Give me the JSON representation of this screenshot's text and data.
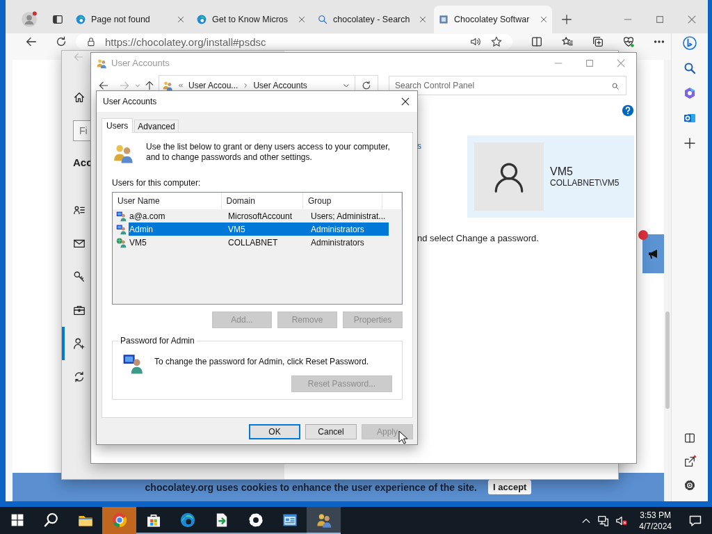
{
  "browser": {
    "tabs": [
      {
        "title": "Page not found",
        "kind": "edge",
        "selected": false
      },
      {
        "title": "Get to Know Micros",
        "kind": "edge",
        "selected": false
      },
      {
        "title": "chocolatey - Search",
        "kind": "search",
        "selected": false
      },
      {
        "title": "Chocolatey Softwar",
        "kind": "site",
        "selected": true
      }
    ],
    "address": "https://chocolatey.org/install#psdsc",
    "cookie_banner": {
      "text": "chocolatey.org uses cookies to enhance the user experience of the site.",
      "button": "I accept"
    }
  },
  "settings_window": {
    "search_placeholder": "Fi",
    "heading": "Acc",
    "nav": [
      {
        "kind": "contact",
        "selected": false
      },
      {
        "kind": "mail",
        "selected": false
      },
      {
        "kind": "key",
        "selected": false
      },
      {
        "kind": "briefcase",
        "selected": false
      },
      {
        "kind": "person-add",
        "selected": true
      },
      {
        "kind": "sync",
        "selected": false
      }
    ]
  },
  "control_panel": {
    "title": "User Accounts",
    "breadcrumb": [
      "User Accou...",
      "User Accounts"
    ],
    "search_placeholder": "Search Control Panel",
    "link_fragment": "s",
    "text_fragment": "nd select Change a password.",
    "user_card": {
      "name": "VM5",
      "account": "COLLABNET\\VM5"
    }
  },
  "dialog": {
    "title": "User Accounts",
    "tabs": [
      {
        "label": "Users",
        "selected": true
      },
      {
        "label": "Advanced",
        "selected": false
      }
    ],
    "intro": "Use the list below to grant or deny users access to your computer, and to change passwords and other settings.",
    "list_label": "Users for this computer:",
    "columns": [
      "User Name",
      "Domain",
      "Group"
    ],
    "rows": [
      {
        "kind": "local",
        "cells": [
          "a@a.com",
          "MicrosoftAccount",
          "Users; Administrat..."
        ],
        "selected": false
      },
      {
        "kind": "local",
        "cells": [
          "Admin",
          "VM5",
          "Administrators"
        ],
        "selected": true
      },
      {
        "kind": "domain",
        "cells": [
          "VM5",
          "COLLABNET",
          "Administrators"
        ],
        "selected": false
      }
    ],
    "list_buttons": [
      {
        "label": "Add...",
        "disabled": true
      },
      {
        "label": "Remove",
        "disabled": true
      },
      {
        "label": "Properties",
        "disabled": true
      }
    ],
    "password_group": {
      "legend": "Password for Admin",
      "text": "To change the password for Admin, click Reset Password.",
      "button": {
        "label": "Reset Password...",
        "disabled": true
      }
    },
    "buttons": [
      {
        "label": "OK",
        "disabled": false
      },
      {
        "label": "Cancel",
        "disabled": false
      },
      {
        "label": "Apply",
        "disabled": true
      }
    ]
  },
  "taskbar": {
    "apps": [
      {
        "kind": "start",
        "running": false,
        "active": false,
        "flashing": false
      },
      {
        "kind": "search",
        "running": false,
        "active": false,
        "flashing": false
      },
      {
        "kind": "folder",
        "running": false,
        "active": false,
        "flashing": false
      },
      {
        "kind": "chrome",
        "running": false,
        "active": false,
        "flashing": true
      },
      {
        "kind": "store",
        "running": true,
        "active": false,
        "flashing": false
      },
      {
        "kind": "edge",
        "running": true,
        "active": false,
        "flashing": false
      },
      {
        "kind": "file-arrow",
        "running": true,
        "active": false,
        "flashing": false
      },
      {
        "kind": "settings",
        "running": true,
        "active": false,
        "flashing": false
      },
      {
        "kind": "control-panel",
        "running": true,
        "active": false,
        "flashing": false
      },
      {
        "kind": "users",
        "running": true,
        "active": true,
        "flashing": false
      }
    ],
    "time": "3:53 PM",
    "date": "4/7/2024"
  }
}
